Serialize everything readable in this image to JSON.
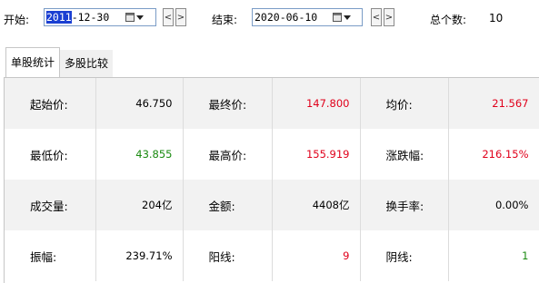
{
  "toolbar": {
    "start_label": "开始:",
    "start_year": "2011",
    "start_rest": "-12-30",
    "end_label": "结束:",
    "end_date": "2020-06-10",
    "total_label": "总个数:",
    "total_value": "10",
    "prev_glyph": "<",
    "next_glyph": ">"
  },
  "tabs": [
    {
      "label": "单股统计",
      "active": true
    },
    {
      "label": "多股比较",
      "active": false
    }
  ],
  "stats": {
    "rows": [
      [
        {
          "label": "起始价:",
          "value": "46.750",
          "color": "black"
        },
        {
          "label": "最终价:",
          "value": "147.800",
          "color": "red"
        },
        {
          "label": "均价:",
          "value": "21.567",
          "color": "red"
        }
      ],
      [
        {
          "label": "最低价:",
          "value": "43.855",
          "color": "green"
        },
        {
          "label": "最高价:",
          "value": "155.919",
          "color": "red"
        },
        {
          "label": "涨跌幅:",
          "value": "216.15%",
          "color": "red"
        }
      ],
      [
        {
          "label": "成交量:",
          "value": "204亿",
          "color": "black"
        },
        {
          "label": "金额:",
          "value": "4408亿",
          "color": "black"
        },
        {
          "label": "换手率:",
          "value": "0.00%",
          "color": "black"
        }
      ],
      [
        {
          "label": "振幅:",
          "value": "239.71%",
          "color": "black"
        },
        {
          "label": "阳线:",
          "value": "9",
          "color": "red"
        },
        {
          "label": "阴线:",
          "value": "1",
          "color": "green"
        }
      ]
    ]
  },
  "colors": {
    "red": "#e0001b",
    "green": "#1a8a10",
    "selection": "#1a3fd2"
  },
  "icons": [
    "calendar-icon",
    "dropdown-arrow-icon",
    "chevron-left-icon",
    "chevron-right-icon"
  ]
}
